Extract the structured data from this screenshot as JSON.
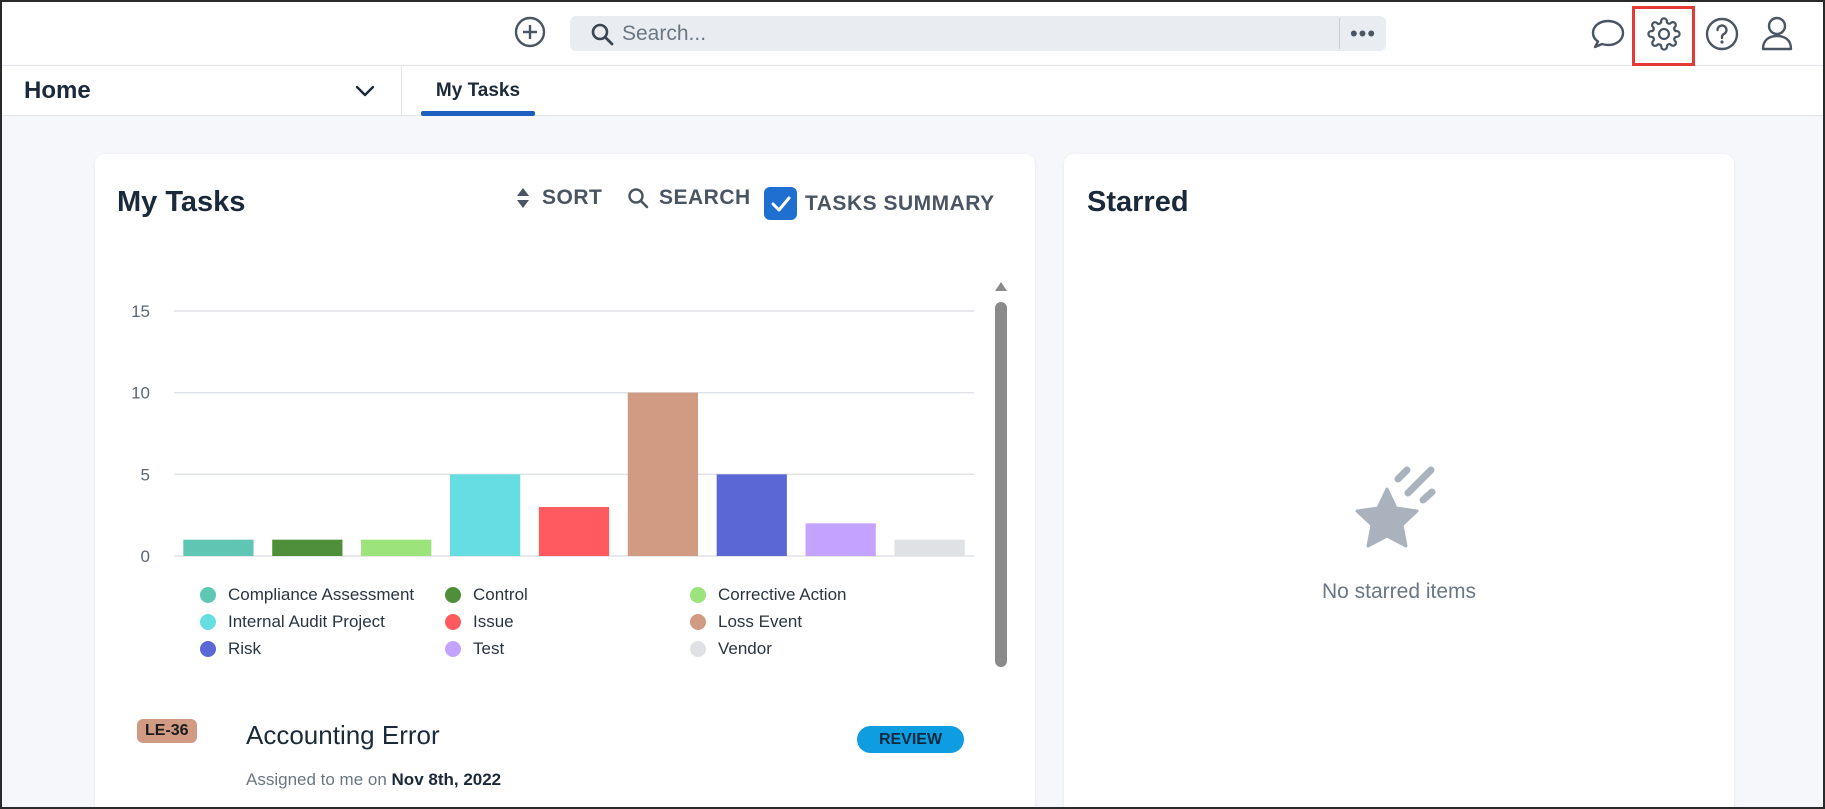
{
  "topbar": {
    "search_placeholder": "Search...",
    "more_label": "•••"
  },
  "nav": {
    "home_label": "Home",
    "tab_label": "My Tasks"
  },
  "tasks_card": {
    "title": "My Tasks",
    "sort_label": "SORT",
    "search_label": "SEARCH",
    "summary_label": "TASKS SUMMARY",
    "summary_checked": true
  },
  "chart_data": {
    "type": "bar",
    "categories": [
      "Compliance Assessment",
      "Control",
      "Corrective Action",
      "Internal Audit Project",
      "Issue",
      "Loss Event",
      "Risk",
      "Test",
      "Vendor"
    ],
    "values": [
      1,
      1,
      1,
      5,
      3,
      10,
      5,
      2,
      1
    ],
    "colors": [
      "#5ec6b3",
      "#4f8f3a",
      "#9be37a",
      "#66dde0",
      "#ff5a5f",
      "#d19a83",
      "#5c67d6",
      "#c4a3ff",
      "#dfe1e4"
    ],
    "yticks": [
      "0",
      "5",
      "10",
      "15"
    ],
    "ylim": [
      0,
      15
    ],
    "grid": true,
    "legend_position": "bottom"
  },
  "task": {
    "badge": "LE-36",
    "badge_color": "#d19a83",
    "title": "Accounting Error",
    "status": "REVIEW",
    "status_color": "#0d9de0",
    "assigned_prefix": "Assigned to me on ",
    "assigned_date": "Nov 8th, 2022"
  },
  "starred_card": {
    "title": "Starred",
    "empty_text": "No starred items"
  }
}
